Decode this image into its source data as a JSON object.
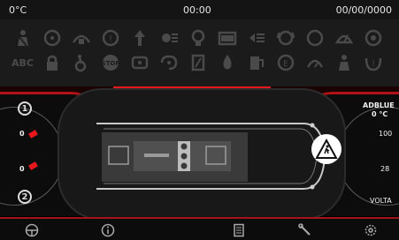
{
  "status": {
    "temperature": "0°C",
    "time": "00:00",
    "date": "00/00/0000"
  },
  "telltale_row1": [
    "seatbelt-icon",
    "steering-warning-icon",
    "brake-pressure-icon",
    "tyre-icon",
    "glow-plug-icon",
    "light-icon",
    "engine-icon",
    "battery-icon",
    "headlight-icon",
    "brake-icon",
    "circle-icon",
    "wiper-icon",
    "oil-icon"
  ],
  "telltale_row2_label": "ABC",
  "telltale_row2": [
    "lock-icon",
    "wheelchair-icon",
    "stop-icon",
    "ecu-icon",
    "pressure-icon",
    "door-icon",
    "fire-icon",
    "fuel-icon",
    "filter-icon",
    "cruise-icon",
    "driver-icon",
    "tyre-pressure-icon"
  ],
  "left_panel": {
    "circuit1": "1",
    "value_top": "0",
    "value_bottom": "0",
    "circuit2": "2"
  },
  "right_panel": {
    "adblue_label": "ADBLUE",
    "temp_value": "0 °C",
    "value_100": "100",
    "value_28": "28",
    "volt_label": "VOLTA"
  },
  "bottom_nav": [
    "steering-wheel-icon",
    "info-icon",
    "checklist-icon",
    "wrench-icon",
    "settings-icon"
  ],
  "colors": {
    "accent": "#e8171d",
    "background": "#000000",
    "panel": "#1b1b1b"
  }
}
